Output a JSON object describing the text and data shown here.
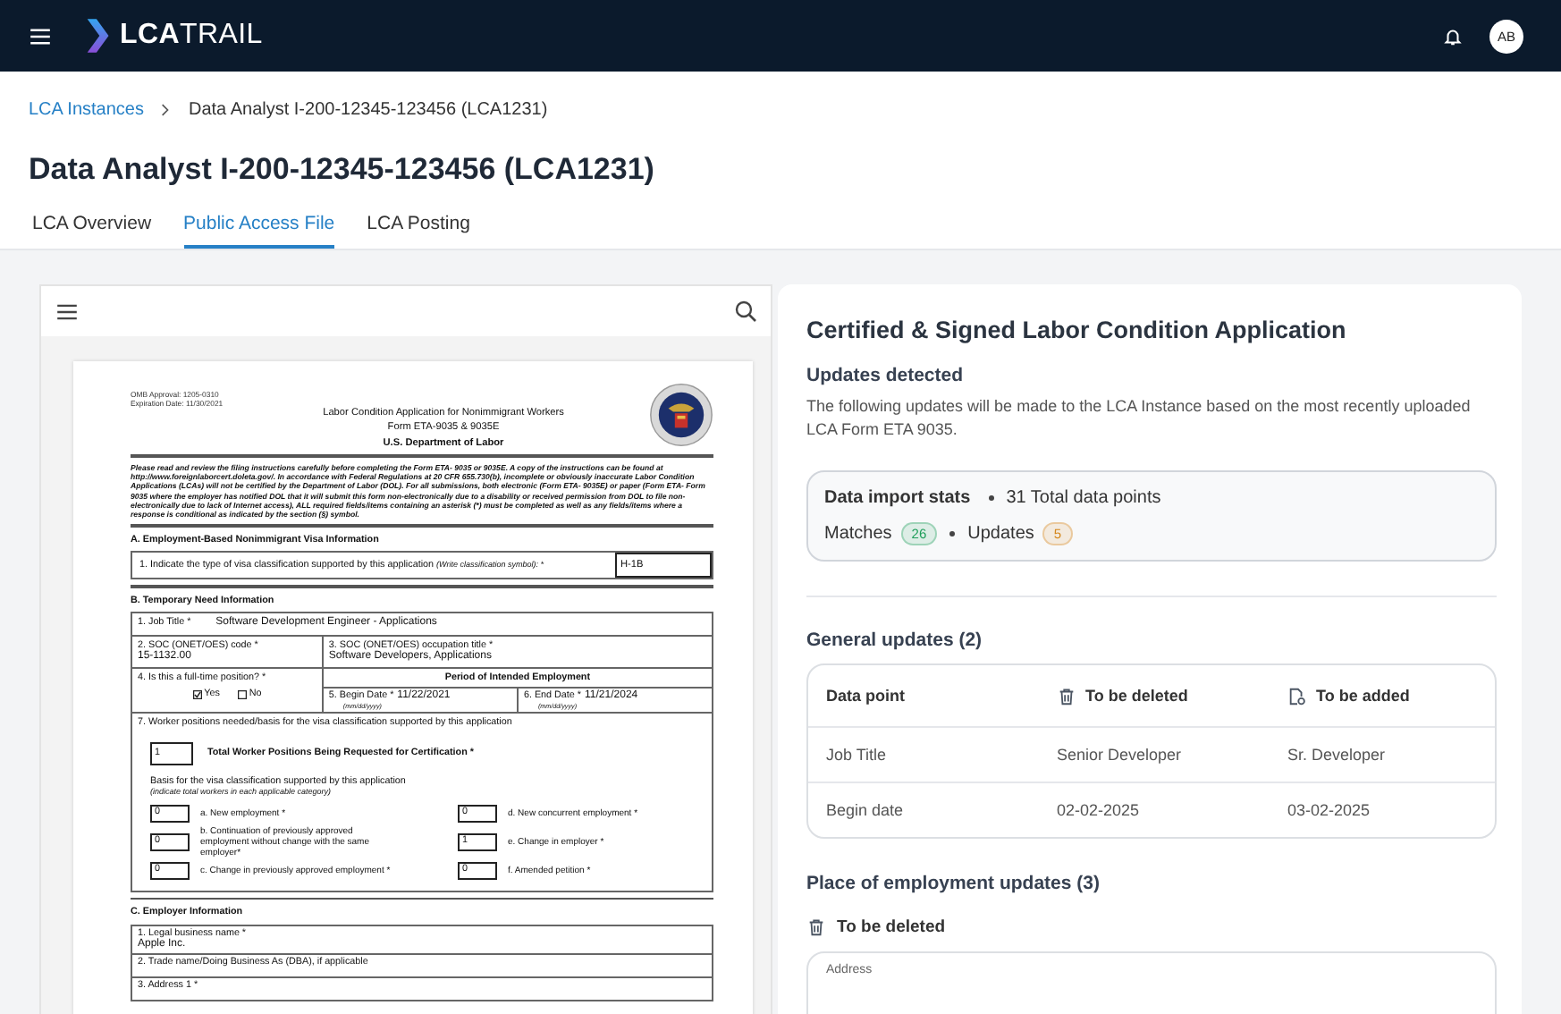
{
  "topbar": {
    "logo": "**LCA**TRAIL",
    "avatar": "AB"
  },
  "breadcrumb": [
    {
      "label": "LCA Instances",
      "kind": "link"
    },
    {
      "label": "Data Analyst I-200-12345-123456 (LCA1231)",
      "kind": "current"
    }
  ],
  "title": "Data Analyst I-200-12345-123456 (LCA1231)",
  "tabs": [
    {
      "label": "LCA Overview",
      "selected": false
    },
    {
      "label": "Public Access File",
      "selected": true
    },
    {
      "label": "LCA Posting",
      "selected": false
    }
  ],
  "document": {
    "omb": "OMB Approval: 1205-0310",
    "expiration": "Expiration Date: 11/30/2021",
    "heading": [
      "Labor Condition Application for Nonimmigrant Workers",
      "Form ETA-9035 & 9035E",
      "U.S. Department of Labor"
    ],
    "instructions": "Please read and review the filing instructions carefully before completing the Form ETA- 9035 or 9035E. A copy of the instructions can be found at http://www.foreignlaborcert.doleta.gov/. In accordance with Federal Regulations at 20 CFR 655.730(b), incomplete or obviously inaccurate Labor Condition Applications (LCAs) will not be certified by the Department of Labor (DOL). For all submissions, both electronic (Form ETA- 9035E) or paper (Form ETA- Form 9035 where the employer has notified DOL that it will submit this form non-electronically due to a disability or received permission from DOL to file non-electronically due to lack of Internet access), ALL required fields/items containing an asterisk (*) must be completed as well as any fields/items where a response is conditional as indicated by the section (§) symbol.",
    "section_a": {
      "title": "A. Employment-Based Nonimmigrant Visa Information",
      "question": "1. Indicate the type of visa classification supported by this application",
      "hint": "(Write classification symbol): *",
      "value": "H-1B"
    },
    "section_b": {
      "title": "B. Temporary Need Information",
      "job_title": {
        "label": "1. Job Title *",
        "value": "Software Development Engineer - Applications"
      },
      "soc_code": {
        "label": "2. SOC (ONET/OES) code *",
        "value": "15-1132.00"
      },
      "soc_title": {
        "label": "3. SOC (ONET/OES) occupation title *",
        "value": "Software Developers, Applications"
      },
      "full_time": {
        "label": "4. Is this a full-time position? *",
        "options": [
          {
            "label": "Yes",
            "checked": true
          },
          {
            "label": "No",
            "checked": false
          }
        ]
      },
      "period": {
        "title": "Period of Intended Employment",
        "dates": [
          {
            "label": "5. Begin Date *",
            "hint": "(mm/dd/yyyy)",
            "value": "11/22/2021"
          },
          {
            "label": "6. End Date *",
            "hint": "(mm/dd/yyyy)",
            "value": "11/21/2024"
          }
        ]
      },
      "positions": {
        "label": "7. Worker positions needed/basis for the visa classification supported by this application",
        "total": "1",
        "total_label": "Total Worker Positions Being Requested for Certification *",
        "basis": "Basis for the visa classification supported by this application",
        "basis_hint": "(indicate total workers in each applicable category)",
        "categories": [
          {
            "count": "0",
            "text": "a. New employment *"
          },
          {
            "count": "0",
            "text": "d. New concurrent employment *"
          },
          {
            "count": "0",
            "text": "b. Continuation of previously approved employment without change with the same employer*"
          },
          {
            "count": "1",
            "text": "e. Change in employer *"
          },
          {
            "count": "0",
            "text": "c. Change in previously approved employment *"
          },
          {
            "count": "0",
            "text": "f. Amended petition *"
          }
        ]
      }
    },
    "section_c": {
      "title": "C. Employer Information",
      "fields": [
        {
          "label": "1. Legal business name *",
          "value": "Apple Inc."
        },
        {
          "label": "2. Trade name/Doing Business As (DBA), if applicable"
        },
        {
          "label": "3. Address 1 *"
        }
      ]
    }
  },
  "review": {
    "title": "Certified & Signed Labor Condition Application",
    "subtitle": "Updates detected",
    "description": "The following updates will be made to the LCA Instance based on the most recently uploaded LCA Form ETA 9035.",
    "stats": {
      "label": "Data import stats",
      "total": "31 Total data points",
      "counts": [
        {
          "label": "Matches",
          "value": "26",
          "color": "#1e9e5a"
        },
        {
          "label": "Updates",
          "value": "5",
          "color": "#d4871c"
        }
      ]
    },
    "general": {
      "title": "General updates (2)",
      "columns": [
        "Data point",
        "To be deleted",
        "To be added"
      ],
      "rows": [
        [
          "Job Title",
          "Senior Developer",
          "Sr. Developer"
        ],
        [
          "Begin date",
          "02-02-2025",
          "03-02-2025"
        ]
      ]
    },
    "place": {
      "title": "Place of employment updates (3)",
      "group": "To be deleted",
      "field_label": "Address"
    }
  }
}
